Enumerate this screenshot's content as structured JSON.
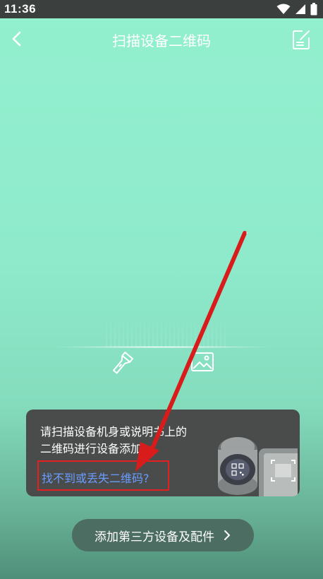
{
  "status_bar": {
    "time": "11:36",
    "icons": [
      "wifi-icon",
      "signal-icon",
      "battery-icon"
    ]
  },
  "header": {
    "title": "扫描设备二维码",
    "back_icon": "chevron-left-icon",
    "right_icon": "edit-note-icon"
  },
  "scanner": {
    "flashlight_icon": "flashlight-icon",
    "album_icon": "image-icon"
  },
  "guide": {
    "text": "请扫描设备机身或说明书上的二维码进行设备添加",
    "link": "找不到或丢失二维码?"
  },
  "bottom_button": {
    "label": "添加第三方设备及配件",
    "icon": "chevron-right-icon"
  },
  "colors": {
    "background_top": "#93f0cf",
    "background_bottom": "#4f8f79",
    "card_bg": "#4a4c4b",
    "link": "#6a9cff",
    "highlight": "#e41f1f",
    "button_bg": "#4c6d62"
  }
}
